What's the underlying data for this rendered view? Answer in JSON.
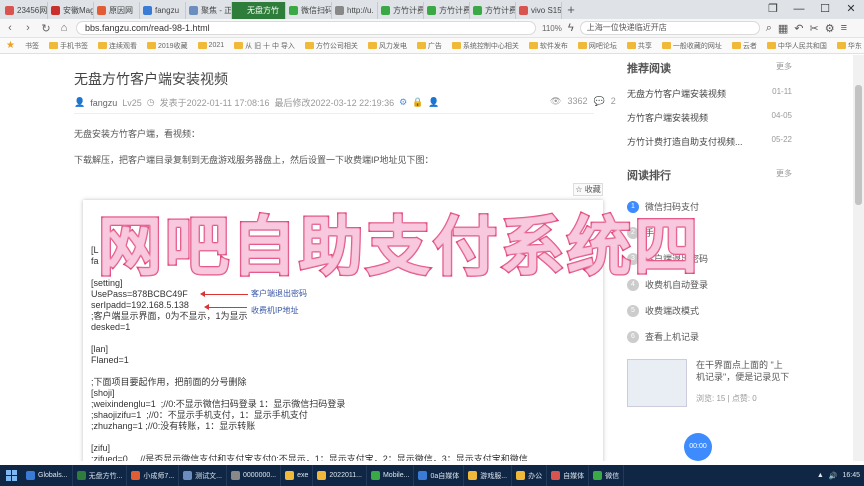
{
  "browser": {
    "tabs": [
      {
        "label": "23456网址",
        "color": "#d9534f"
      },
      {
        "label": "安徽Mag",
        "color": "#c9302c"
      },
      {
        "label": "原因网",
        "color": "#e25d33"
      },
      {
        "label": "fangzu",
        "color": "#3a7bd5"
      },
      {
        "label": "聚焦 - 正剧",
        "color": "#6c8ebf"
      },
      {
        "label": "无盘方竹",
        "color": "#2e7d3a",
        "active": true
      },
      {
        "label": "微信扫码",
        "color": "#3aa845"
      },
      {
        "label": "http://u.",
        "color": "#888888"
      },
      {
        "label": "方竹计费",
        "color": "#3aa845"
      },
      {
        "label": "方竹计费",
        "color": "#3aa845"
      },
      {
        "label": "方竹计费",
        "color": "#3aa845"
      },
      {
        "label": "vivo S15",
        "color": "#d9534f"
      }
    ],
    "url": "bbs.fangzu.com/read-98-1.html",
    "zoom": "110%",
    "search_text": "上海一位快递临近开店",
    "bookmarks": [
      "书签",
      "手机书签",
      "连续观看",
      "2019收藏",
      "2021",
      "从 旧 十 中 导入",
      "方竹公司相关",
      "风力发电",
      "广告",
      "系统控制中心相关",
      "软件发布",
      "网吧论坛",
      "共享",
      "一般收藏的网址",
      "云者",
      "中华人民共和国",
      "华东"
    ]
  },
  "post": {
    "title": "无盘方竹客户端安装视频",
    "author": "fangzu",
    "level": "Lv25",
    "published": "发表于2022-01-11 17:08:16",
    "edited": "最后修改2022-03-12 22:19:36",
    "views": "3362",
    "replies": "2",
    "para1": "无盘安装方竹客户端，看视频：",
    "para2": "下载解压，把客户端目录复制到无盘游戏服务器盘上，然后设置一下收费端IP地址见下图：",
    "favorite": "收藏",
    "code_lines": [
      "[L",
      "fa",
      "",
      "[setting]",
      "UsePass=878BCBC49F",
      "serIpadd=192.168.5.138",
      ";客户端显示界面，0为不显示，1为显示",
      "desked=1",
      "",
      "[lan]",
      "Flaned=1",
      "",
      ";下面项目要起作用，把前面的分号删除",
      "[shoji]",
      ";weixindenglu=1  ;//0:不显示微信扫码登录 1：显示微信扫码登录",
      ";shaojizifu=1  ;//0：不显示手机支付，1：显示手机支付",
      ";zhuzhang=1 ;//0:没有转账，1：显示转账",
      "",
      "[zifu]",
      ";zifued=0     //是否显示微信支付和支付宝支付0:不显示，1：显示支付宝，2：显示微信，3：显示支付宝和微信"
    ],
    "annotation_password": "客户端退出密码",
    "annotation_ip": "收费机IP地址"
  },
  "sidebar": {
    "recommended_title": "推荐阅读",
    "more1": "更多",
    "recommended": [
      {
        "title": "无盘方竹客户端安装视频",
        "date": "01-11"
      },
      {
        "title": "方竹客户端安装视频",
        "date": "04-05"
      },
      {
        "title": "方竹计费打造自助支付视频...",
        "date": "05-22"
      }
    ],
    "ranking_title": "阅读排行",
    "more2": "更多",
    "ranking": [
      {
        "n": "1",
        "title": "微信扫码支付"
      },
      {
        "n": "2",
        "title": "手机"
      },
      {
        "n": "3",
        "title": "客户端退出密码"
      },
      {
        "n": "4",
        "title": "收费机自动登录"
      },
      {
        "n": "5",
        "title": "收费端改模式"
      },
      {
        "n": "6",
        "title": "查看上机记录"
      }
    ],
    "thumb_title": "在干界面点上面的 \"上机记录\"，便是记录见下",
    "thumb_meta": "浏览: 15 | 点赞: 0"
  },
  "float_button": "00:00",
  "overlay_text": "网吧自助支付系统四",
  "taskbar": {
    "items": [
      {
        "label": "Globals...",
        "color": "#3a7bd5"
      },
      {
        "label": "无盘方竹...",
        "color": "#2e7d3a"
      },
      {
        "label": "小成师7...",
        "color": "#e25d33"
      },
      {
        "label": "测试文...",
        "color": "#6c8ebf"
      },
      {
        "label": "0000000...",
        "color": "#888888"
      },
      {
        "label": "exe",
        "color": "#f0b93a"
      },
      {
        "label": "2022011...",
        "color": "#f0b93a"
      },
      {
        "label": "Mobile...",
        "color": "#3aa845"
      },
      {
        "label": "0a自媒体",
        "color": "#3a7bd5"
      },
      {
        "label": "游戏服...",
        "color": "#f0b93a"
      },
      {
        "label": "办公",
        "color": "#f0b93a"
      },
      {
        "label": "自媒体",
        "color": "#d9534f"
      },
      {
        "label": "微信",
        "color": "#3aa845"
      }
    ],
    "clock": "16:45"
  }
}
